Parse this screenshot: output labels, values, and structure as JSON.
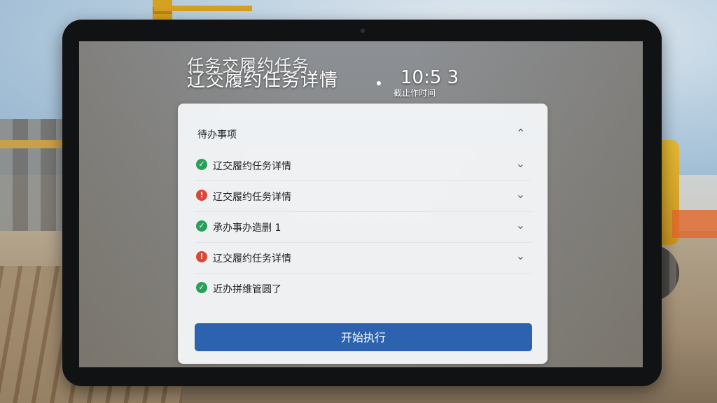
{
  "screen": {
    "header_line1": "任务交履约任务",
    "header_line2": "辽交履约任务详情",
    "clock": "10:5 3",
    "deadline_label": "截止作时间"
  },
  "list": {
    "heading": "待办事项",
    "items": [
      {
        "label": "辽交履约任务详情",
        "status": "done"
      },
      {
        "label": "辽交履约任务详情",
        "status": "alert"
      },
      {
        "label": "承办事办造删 1",
        "status": "done"
      },
      {
        "label": "辽交履约任务详情",
        "status": "alert"
      },
      {
        "label": "近办拼维管圆了",
        "status": "done"
      }
    ]
  },
  "action": {
    "start_label": "开始执行"
  },
  "colors": {
    "primary": "#2c62b0",
    "done": "#27a05a",
    "alert": "#d9463a"
  },
  "icons": {
    "done": "check-circle-icon",
    "alert": "heart-alert-icon",
    "expand": "chevron-down-icon",
    "collapse": "chevron-up-icon"
  }
}
